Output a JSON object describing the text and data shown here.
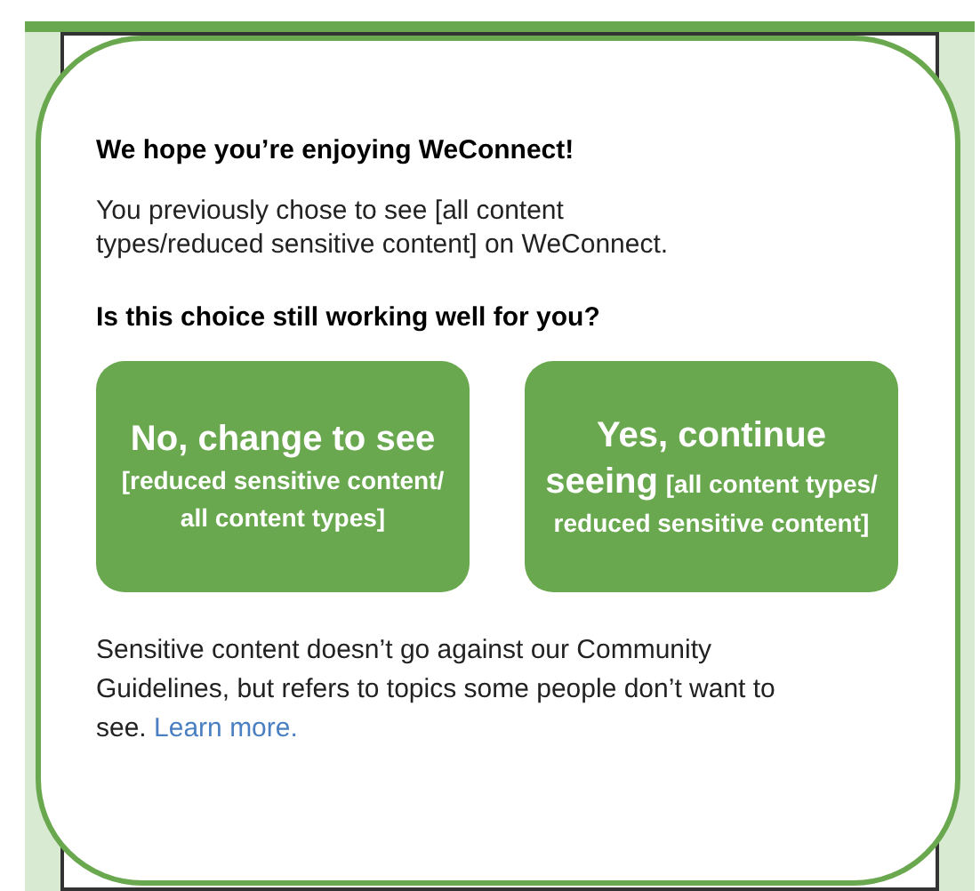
{
  "dialog": {
    "title": "We hope you’re enjoying WeConnect!",
    "message": "You previously chose to see [all content types/reduced sensitive content] on WeConnect.",
    "question": "Is this choice still working well for you?",
    "buttons": [
      {
        "label": "No, change to see",
        "detail": "[reduced sensitive content/ all content types]"
      },
      {
        "label": "Yes, continue seeing",
        "detail": "[all content types/ reduced sensitive content]"
      }
    ],
    "footer": "Sensitive content doesn’t go against our Community Guidelines, but refers to topics some people don’t want to see.",
    "link": "Learn more."
  }
}
